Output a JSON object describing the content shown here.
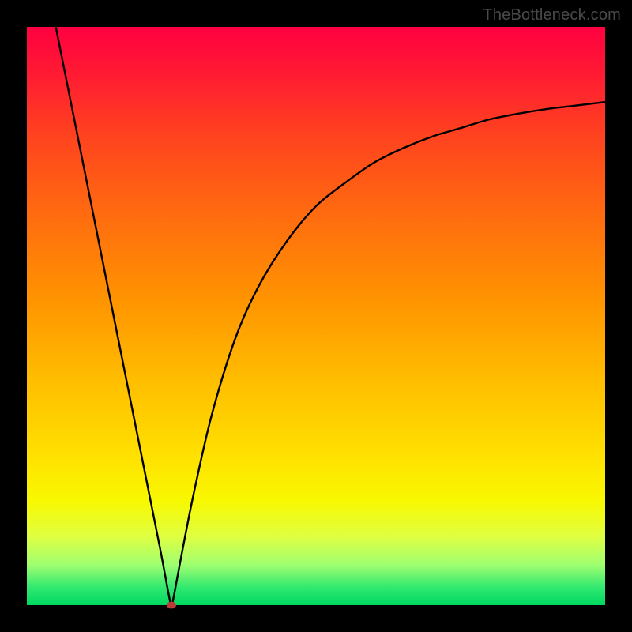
{
  "watermark": {
    "text": "TheBottleneck.com"
  },
  "chart_data": {
    "type": "line",
    "title": "",
    "xlabel": "",
    "ylabel": "",
    "xlim": [
      0,
      100
    ],
    "ylim": [
      0,
      100
    ],
    "grid": false,
    "legend": false,
    "background": "rainbow-vertical-gradient",
    "notch": {
      "x": 25,
      "y": 0
    },
    "series": [
      {
        "name": "bottleneck-curve",
        "x": [
          5,
          10,
          15,
          20,
          23,
          24.5,
          25,
          25.5,
          27,
          29,
          32,
          36,
          40,
          45,
          50,
          55,
          60,
          65,
          70,
          75,
          80,
          85,
          90,
          95,
          100
        ],
        "y": [
          100,
          75,
          50,
          25,
          10,
          2,
          0,
          2,
          10,
          20,
          33,
          46,
          55,
          63,
          69,
          73,
          76.5,
          79,
          81,
          82.5,
          84,
          85,
          85.8,
          86.4,
          87
        ]
      }
    ]
  }
}
